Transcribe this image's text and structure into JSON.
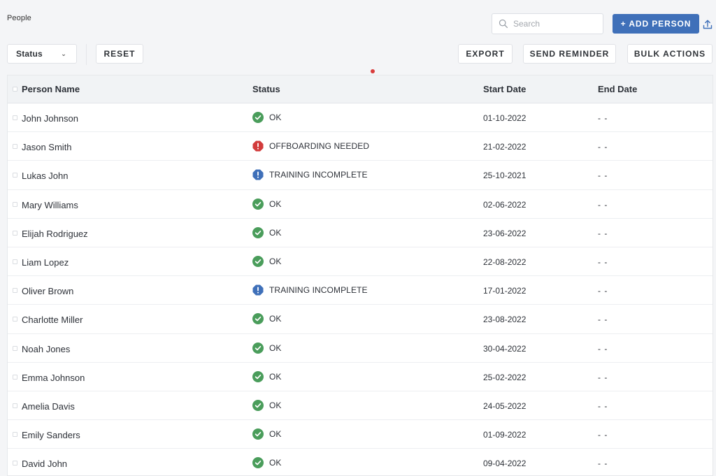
{
  "page": {
    "title": "People"
  },
  "search": {
    "placeholder": "Search"
  },
  "actions": {
    "add_person": "+ ADD PERSON",
    "status_filter": "Status",
    "reset": "RESET",
    "export": "EXPORT",
    "send_reminder": "SEND REMINDER",
    "bulk_actions": "BULK ACTIONS"
  },
  "colors": {
    "primary": "#3f70b9",
    "ok": "#4a9d5b",
    "error": "#d23b3b",
    "warning": "#3f70b9"
  },
  "table": {
    "headers": {
      "name": "Person Name",
      "status": "Status",
      "start_date": "Start Date",
      "end_date": "End Date"
    },
    "rows": [
      {
        "name": "John Johnson",
        "status": "OK",
        "status_type": "ok",
        "start_date": "01-10-2022",
        "end_date": "- -"
      },
      {
        "name": "Jason Smith",
        "status": "OFFBOARDING NEEDED",
        "status_type": "error",
        "start_date": "21-02-2022",
        "end_date": "- -"
      },
      {
        "name": "Lukas John",
        "status": "TRAINING INCOMPLETE",
        "status_type": "warning",
        "start_date": "25-10-2021",
        "end_date": "- -"
      },
      {
        "name": "Mary Williams",
        "status": "OK",
        "status_type": "ok",
        "start_date": "02-06-2022",
        "end_date": "- -"
      },
      {
        "name": "Elijah Rodriguez",
        "status": "OK",
        "status_type": "ok",
        "start_date": "23-06-2022",
        "end_date": "- -"
      },
      {
        "name": "Liam Lopez",
        "status": "OK",
        "status_type": "ok",
        "start_date": "22-08-2022",
        "end_date": "- -"
      },
      {
        "name": "Oliver Brown",
        "status": "TRAINING INCOMPLETE",
        "status_type": "warning",
        "start_date": "17-01-2022",
        "end_date": "- -"
      },
      {
        "name": "Charlotte Miller",
        "status": "OK",
        "status_type": "ok",
        "start_date": "23-08-2022",
        "end_date": "- -"
      },
      {
        "name": "Noah Jones",
        "status": "OK",
        "status_type": "ok",
        "start_date": "30-04-2022",
        "end_date": "- -"
      },
      {
        "name": "Emma Johnson",
        "status": "OK",
        "status_type": "ok",
        "start_date": "25-02-2022",
        "end_date": "- -"
      },
      {
        "name": "Amelia Davis",
        "status": "OK",
        "status_type": "ok",
        "start_date": "24-05-2022",
        "end_date": "- -"
      },
      {
        "name": "Emily Sanders",
        "status": "OK",
        "status_type": "ok",
        "start_date": "01-09-2022",
        "end_date": "- -"
      },
      {
        "name": "David John",
        "status": "OK",
        "status_type": "ok",
        "start_date": "09-04-2022",
        "end_date": "- -"
      }
    ]
  }
}
